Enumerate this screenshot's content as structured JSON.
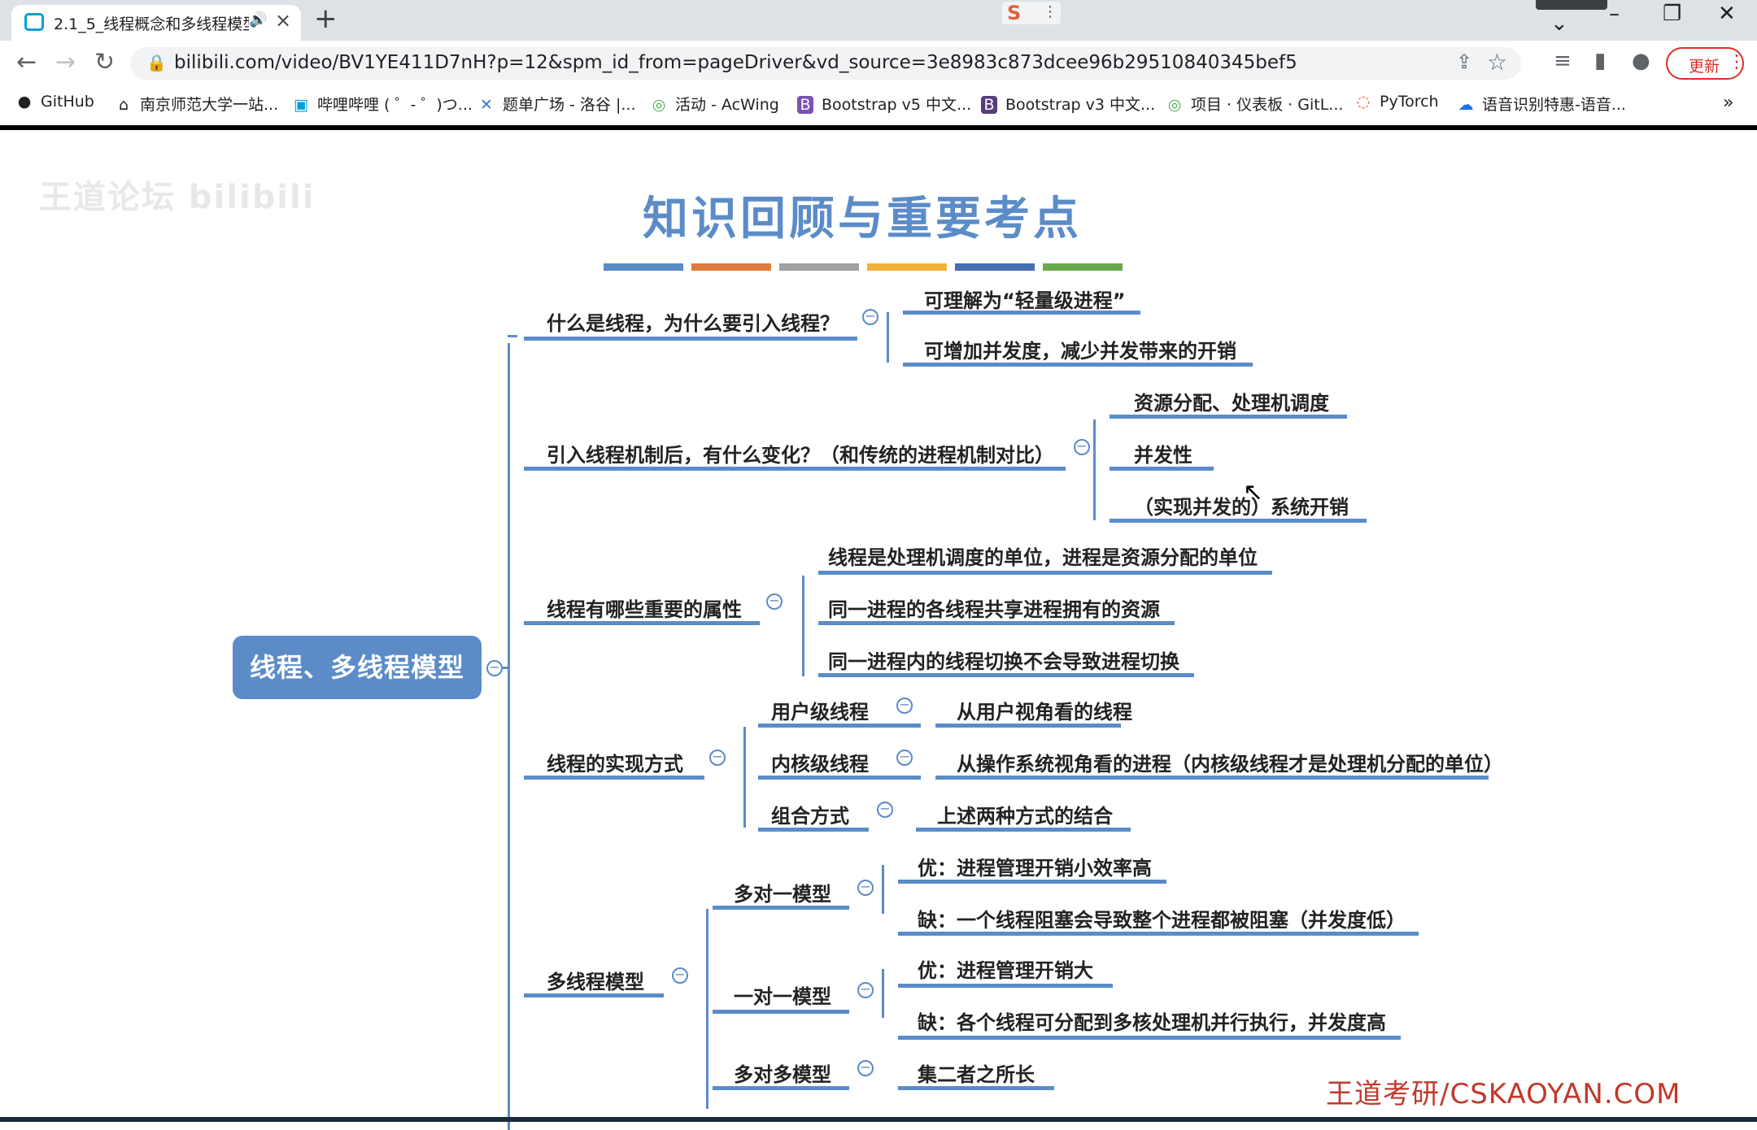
{
  "browser": {
    "tab_title": "2.1_5_线程概念和多线程模型",
    "url": "bilibili.com/video/BV1YE411D7nH?p=12&spm_id_from=pageDriver&vd_source=3e8983c873dcee96b29510840345bef5",
    "update_label": "更新",
    "bookmarks": [
      {
        "label": "GitHub",
        "icon": "github-icon"
      },
      {
        "label": "南京师范大学一站...",
        "icon": "home-icon"
      },
      {
        "label": "哔哩哔哩 ( ゜- ゜)つ...",
        "icon": "bilibili-icon"
      },
      {
        "label": "题单广场 - 洛谷 |...",
        "icon": "luogu-icon"
      },
      {
        "label": "活动 - AcWing",
        "icon": "acwing-icon"
      },
      {
        "label": "Bootstrap v5 中文...",
        "icon": "bootstrap-icon"
      },
      {
        "label": "Bootstrap v3 中文...",
        "icon": "bootstrap-icon"
      },
      {
        "label": "项目 · 仪表板 · GitL...",
        "icon": "gitlab-icon"
      },
      {
        "label": "PyTorch",
        "icon": "pytorch-icon"
      },
      {
        "label": "语音识别特惠-语音...",
        "icon": "cloud-icon"
      }
    ],
    "more_bookmarks": "»"
  },
  "slide": {
    "watermark": "王道论坛 bilibili",
    "title": "知识回顾与重要考点",
    "color_bars": [
      "#5b8cc8",
      "#e07a3c",
      "#a0a0a0",
      "#f2b23a",
      "#4a6fb0",
      "#6aa84f"
    ],
    "root": "线程、多线程模型",
    "footer": "王道考研/CSKAOYAN.COM",
    "branches": {
      "b1": {
        "label": "什么是线程，为什么要引入线程？",
        "children": [
          "可理解为“轻量级进程”",
          "可增加并发度，减少并发带来的开销"
        ]
      },
      "b2": {
        "label": "引入线程机制后，有什么变化？（和传统的进程机制对比）",
        "children": [
          "资源分配、处理机调度",
          "并发性",
          "（实现并发的）系统开销"
        ]
      },
      "b3": {
        "label": "线程有哪些重要的属性",
        "children": [
          "线程是处理机调度的单位，进程是资源分配的单位",
          "同一进程的各线程共享进程拥有的资源",
          "同一进程内的线程切换不会导致进程切换"
        ]
      },
      "b4": {
        "label": "线程的实现方式",
        "children": [
          {
            "label": "用户级线程",
            "detail": "从用户视角看的线程"
          },
          {
            "label": "内核级线程",
            "detail": "从操作系统视角看的进程（内核级线程才是处理机分配的单位）"
          },
          {
            "label": "组合方式",
            "detail": "上述两种方式的结合"
          }
        ]
      },
      "b5": {
        "label": "多线程模型",
        "children": [
          {
            "label": "多对一模型",
            "details": [
              "优：进程管理开销小效率高",
              "缺：一个线程阻塞会导致整个进程都被阻塞（并发度低）"
            ]
          },
          {
            "label": "一对一模型",
            "details": [
              "优：进程管理开销大",
              "缺：各个线程可分配到多核处理机并行执行，并发度高"
            ]
          },
          {
            "label": "多对多模型",
            "details": [
              "集二者之所长"
            ]
          }
        ]
      }
    }
  }
}
